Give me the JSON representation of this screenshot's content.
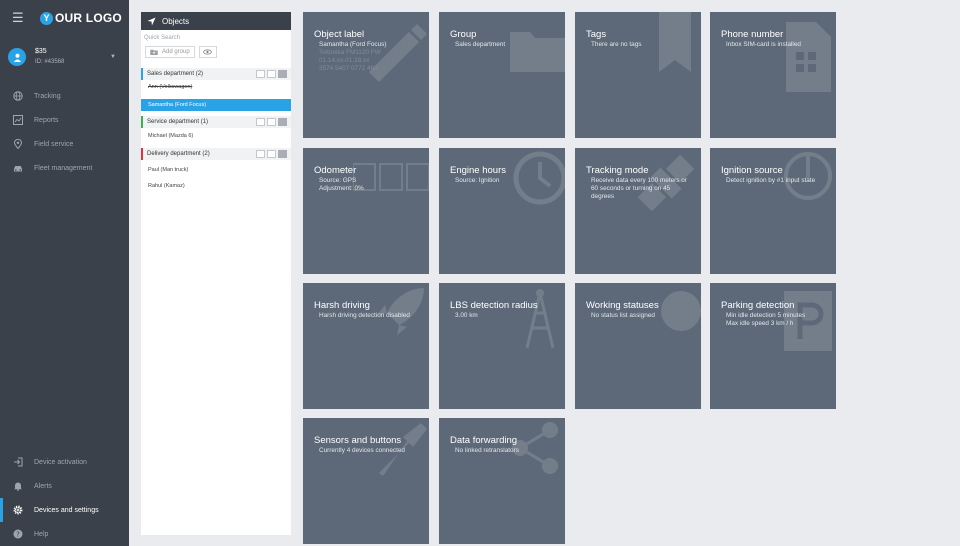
{
  "logo": {
    "letter": "Y",
    "text": "OUR LOGO"
  },
  "user": {
    "name": "$35",
    "id": "ID: #43568"
  },
  "nav_top": [
    {
      "label": "Tracking",
      "icon": "globe-icon"
    },
    {
      "label": "Reports",
      "icon": "chart-icon"
    },
    {
      "label": "Field service",
      "icon": "pin-icon"
    },
    {
      "label": "Fleet management",
      "icon": "car-icon"
    }
  ],
  "nav_bottom": [
    {
      "label": "Device activation",
      "icon": "login-icon"
    },
    {
      "label": "Alerts",
      "icon": "bell-icon"
    },
    {
      "label": "Devices and settings",
      "icon": "gear-icon",
      "active": true
    },
    {
      "label": "Help",
      "icon": "help-icon"
    }
  ],
  "objects_panel": {
    "title": "Objects",
    "quick_search": "Quick Search",
    "add_group": "Add group",
    "groups": [
      {
        "name": "Sales department (2)",
        "color": "#2aa3e6"
      },
      {
        "name": "Service department (1)",
        "color": "#3fae5a"
      },
      {
        "name": "Delivery department (2)",
        "color": "#d9363e"
      }
    ],
    "items": [
      {
        "name": "Ann (Volkswagen)",
        "strike": true
      },
      {
        "name": "Samantha (Ford Focus)",
        "selected": true
      },
      {
        "name": "Michael (Mazda 6)"
      },
      {
        "name": "Paul (Man truck)"
      },
      {
        "name": "Rahul (Kamaz)"
      }
    ]
  },
  "tiles": [
    {
      "title": "Object label",
      "lines": [
        "Samantha (Ford Focus)"
      ],
      "muted": [
        "Teltonika FM1120 FW",
        "01.14.xx-01.18.xx",
        "3574 5407 0772 460"
      ],
      "icon": "pencil-icon"
    },
    {
      "title": "Group",
      "lines": [
        "Sales department"
      ],
      "icon": "folder-icon"
    },
    {
      "title": "Tags",
      "lines": [
        "There are no tags"
      ],
      "icon": "bookmark-icon"
    },
    {
      "title": "Phone number",
      "lines": [
        "Inbox SIM-card is installed"
      ],
      "icon": "sim-card-icon"
    },
    {
      "title": "Odometer",
      "lines": [
        "Source: GPS",
        "Adjustment: 0%"
      ],
      "icon": "odometer-digits-icon"
    },
    {
      "title": "Engine hours",
      "lines": [
        "Source: Ignition"
      ],
      "icon": "clock-icon"
    },
    {
      "title": "Tracking mode",
      "lines": [
        "Receive data every 100 meters or 60 seconds or turning on 45 degrees"
      ],
      "icon": "satellite-icon"
    },
    {
      "title": "Ignition source",
      "lines": [
        "Detect ignition by #1 input state"
      ],
      "icon": "power-icon"
    },
    {
      "title": "Harsh driving",
      "lines": [
        "Harsh driving detection disabled"
      ],
      "icon": "rocket-icon"
    },
    {
      "title": "LBS detection radius",
      "lines": [
        "3.00 km"
      ],
      "icon": "antenna-icon"
    },
    {
      "title": "Working statuses",
      "lines": [
        "No status list assigned"
      ],
      "icon": "circle-icon"
    },
    {
      "title": "Parking detection",
      "lines": [
        "Min idle detection 5 minutes",
        "Max idle speed 3 km / h"
      ],
      "icon": "parking-icon"
    },
    {
      "title": "Sensors and buttons",
      "lines": [
        "Currently 4 devices connected"
      ],
      "icon": "wrench-icon"
    },
    {
      "title": "Data forwarding",
      "lines": [
        "No linked retranslators"
      ],
      "icon": "share-icon"
    }
  ]
}
